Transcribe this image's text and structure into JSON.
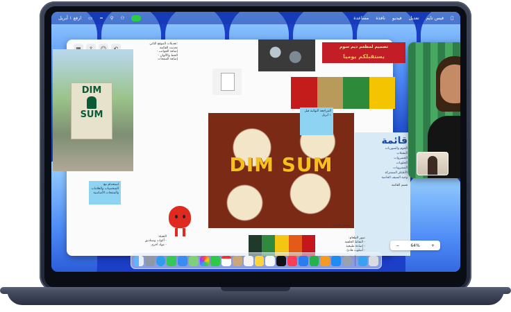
{
  "menubar": {
    "right_items": [
      "فيس تايم",
      "تعديل",
      "فيديو",
      "نافذة",
      "مساعدة"
    ],
    "clock": "الأربعاء ٩:٤١ صباحًا",
    "left_status": "ارفع ١ أبريل"
  },
  "freeform": {
    "doc_title_lines": [
      "تعديلات الموقع الثاني:",
      "تحديث القائمة",
      "- إضافة الجوانب",
      "- الخط والألوان",
      "إضافة المنتجات"
    ],
    "poster_text": [
      "DIM",
      "SUM"
    ],
    "banner_text": [
      "تصميم لمطعم ديم سوم",
      "يستقبلكم يوميا"
    ],
    "main_title": "DIM SUM",
    "main_caption": "تصميم_الشعار_١",
    "sticky_1": "المراجعة النهائية قبل ١ أبريل",
    "sticky_2": "استخدام مع الشخصيات والعلامات والمنتجات الأساسية",
    "menu_heading": "قائمة",
    "menu_items": [
      "الحوم والشوربات",
      "المقبلات",
      "الخضروات",
      "الحلويات",
      "المشروبات",
      "الأطباق المشتركة",
      "وجبة الشيف الخاصة"
    ],
    "bottom_notes_left": [
      "التعبئة:",
      "- أكواب وصناديق",
      "- مواد أخرى"
    ],
    "bottom_notes_right": [
      "صور الطعام:",
      "- التقاط الخلفية",
      "- إضاءة طبيعية",
      "- أسلوب هادئ"
    ],
    "menu_caption": "قسم القائمة",
    "zoom_level": "64%",
    "zoom_minus": "−",
    "zoom_plus": "+"
  },
  "facetime": {
    "remote_person": "participant-video",
    "self_view": "self-view"
  },
  "colors": {
    "wallpaper": "#1e4fd6",
    "swatches": [
      "#1f3a2a",
      "#2f8a3f",
      "#f2c613",
      "#e45a18",
      "#c3161d"
    ],
    "tiles": [
      "#c41b1b",
      "#b99a5a",
      "#2e8a3b",
      "#f5c400"
    ]
  },
  "dock": {
    "icons": [
      "finder-icon",
      "launchpad-icon",
      "safari-icon",
      "messages-icon",
      "mail-icon",
      "maps-icon",
      "photos-icon",
      "facetime-icon",
      "calendar-icon",
      "contacts-icon",
      "reminders-icon",
      "notes-icon",
      "freeform-icon",
      "tv-icon",
      "music-icon",
      "keynote-icon",
      "numbers-icon",
      "pages-icon",
      "app-store-icon",
      "system-settings-icon",
      "downloads-icon",
      "trash-icon"
    ]
  }
}
